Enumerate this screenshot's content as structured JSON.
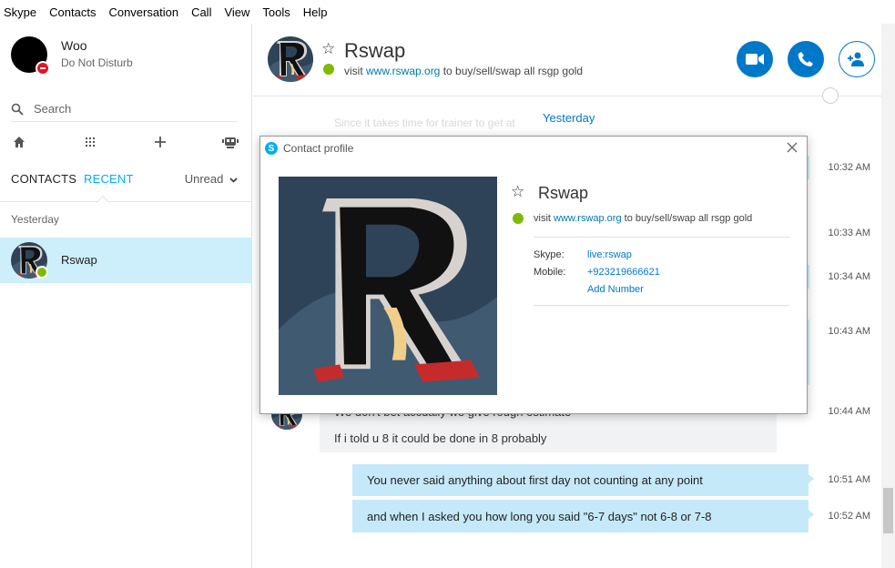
{
  "menu": [
    "Skype",
    "Contacts",
    "Conversation",
    "Call",
    "View",
    "Tools",
    "Help"
  ],
  "me": {
    "name": "Woo",
    "status": "Do Not Disturb"
  },
  "search": {
    "label": "Search"
  },
  "tabs": {
    "contacts": "CONTACTS",
    "recent": "RECENT",
    "filter": "Unread"
  },
  "recent": {
    "group": "Yesterday",
    "items": [
      {
        "name": "Rswap"
      }
    ]
  },
  "conversation": {
    "name": "Rswap",
    "mood_prefix": "visit ",
    "mood_link": "www.rswap.org",
    "mood_suffix": " to buy/sell/swap all rsgp gold",
    "date_separator": "Yesterday",
    "faded_text": "Since it takes time for trainer to get at",
    "times": [
      "10:32 AM",
      "10:33 AM",
      "10:34 AM",
      "10:43 AM",
      "10:44 AM",
      "10:51 AM",
      "10:52 AM"
    ],
    "messages": [
      {
        "text": "We don't bet accuaily we give rough estimate",
        "direction": "in"
      },
      {
        "text": "If i told u 8 it could be done in 8 probably",
        "direction": "in"
      },
      {
        "text": "You never said anything about first day not counting at any point",
        "direction": "out"
      },
      {
        "text": "and when I asked you how long you said \"6-7 days\" not 6-8 or 7-8",
        "direction": "out"
      }
    ]
  },
  "profile_dialog": {
    "title": "Contact profile",
    "name": "Rswap",
    "mood_prefix": "visit ",
    "mood_link": "www.rswap.org",
    "mood_suffix": " to buy/sell/swap all rsgp gold",
    "skype_label": "Skype:",
    "skype_value": "live:rswap",
    "mobile_label": "Mobile:",
    "mobile_value": "+923219666621",
    "add_number": "Add Number"
  },
  "colors": {
    "accent": "#00aff0",
    "call_button": "#0078c8",
    "selected_row": "#cdeefb",
    "outgoing_bubble": "#c6e9f9",
    "incoming_bubble": "#f0f2f4",
    "online": "#7fba00",
    "dnd": "#e81123"
  },
  "icons": [
    "search-icon",
    "home-icon",
    "dialpad-icon",
    "plus-icon",
    "bot-icon",
    "star-icon",
    "video-icon",
    "phone-icon",
    "add-person-icon",
    "globe-icon",
    "close-icon",
    "skype-icon",
    "chevron-down-icon"
  ]
}
